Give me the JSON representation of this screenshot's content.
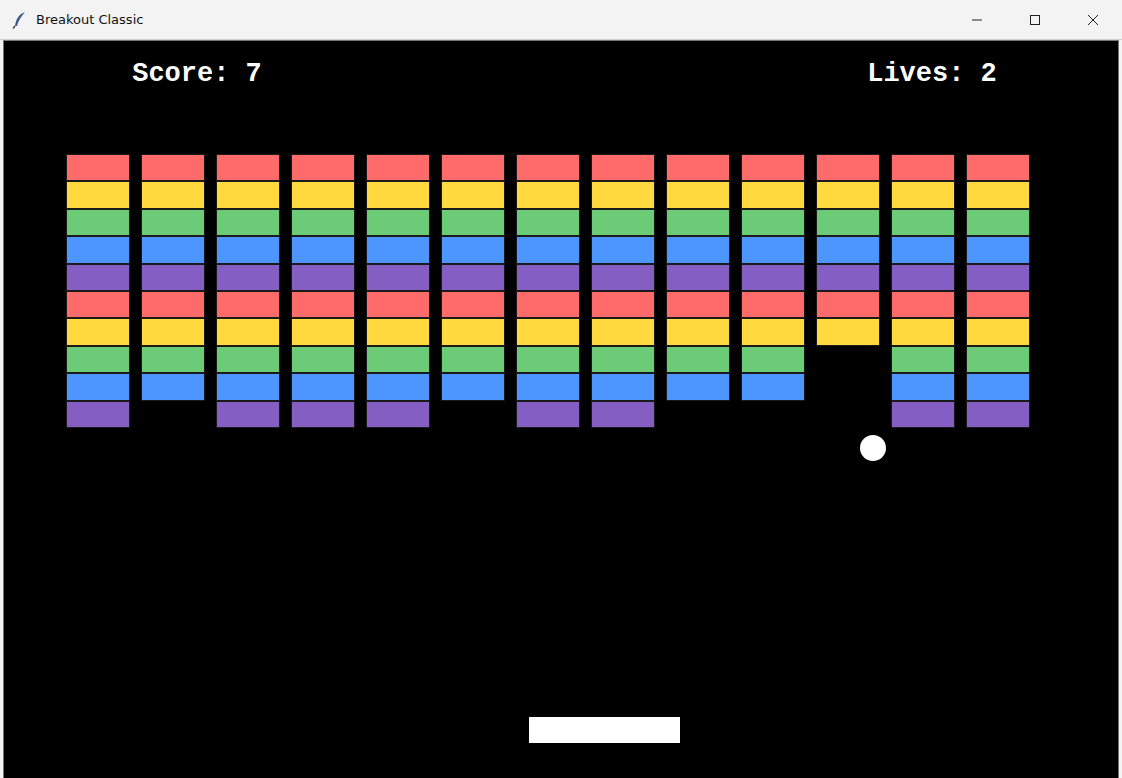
{
  "window": {
    "title": "Breakout Classic"
  },
  "hud": {
    "score": "Score: 7",
    "lives": "Lives: 2"
  },
  "bricks": {
    "rows": [
      {
        "color": "#ff6b6b",
        "bricks": [
          {
            "hit": false
          },
          {
            "hit": false
          },
          {
            "hit": false
          },
          {
            "hit": false
          },
          {
            "hit": false
          },
          {
            "hit": false
          },
          {
            "hit": false
          },
          {
            "hit": false
          },
          {
            "hit": false
          },
          {
            "hit": false
          },
          {
            "hit": false
          },
          {
            "hit": false
          },
          {
            "hit": false
          }
        ]
      },
      {
        "color": "#ffd93d",
        "bricks": [
          {
            "hit": false
          },
          {
            "hit": false
          },
          {
            "hit": false
          },
          {
            "hit": false
          },
          {
            "hit": false
          },
          {
            "hit": false
          },
          {
            "hit": false
          },
          {
            "hit": false
          },
          {
            "hit": false
          },
          {
            "hit": false
          },
          {
            "hit": false
          },
          {
            "hit": false
          },
          {
            "hit": false
          }
        ]
      },
      {
        "color": "#6bcb77",
        "bricks": [
          {
            "hit": false
          },
          {
            "hit": false
          },
          {
            "hit": false
          },
          {
            "hit": false
          },
          {
            "hit": false
          },
          {
            "hit": false
          },
          {
            "hit": false
          },
          {
            "hit": false
          },
          {
            "hit": false
          },
          {
            "hit": false
          },
          {
            "hit": false
          },
          {
            "hit": false
          },
          {
            "hit": false
          }
        ]
      },
      {
        "color": "#4d96ff",
        "bricks": [
          {
            "hit": false
          },
          {
            "hit": false
          },
          {
            "hit": false
          },
          {
            "hit": false
          },
          {
            "hit": false
          },
          {
            "hit": false
          },
          {
            "hit": false
          },
          {
            "hit": false
          },
          {
            "hit": false
          },
          {
            "hit": false
          },
          {
            "hit": false
          },
          {
            "hit": false
          },
          {
            "hit": false
          }
        ]
      },
      {
        "color": "#845ec2",
        "bricks": [
          {
            "hit": false
          },
          {
            "hit": false
          },
          {
            "hit": false
          },
          {
            "hit": false
          },
          {
            "hit": false
          },
          {
            "hit": false
          },
          {
            "hit": false
          },
          {
            "hit": false
          },
          {
            "hit": false
          },
          {
            "hit": false
          },
          {
            "hit": false
          },
          {
            "hit": false
          },
          {
            "hit": false
          }
        ]
      },
      {
        "color": "#ff6b6b",
        "bricks": [
          {
            "hit": false
          },
          {
            "hit": false
          },
          {
            "hit": false
          },
          {
            "hit": false
          },
          {
            "hit": false
          },
          {
            "hit": false
          },
          {
            "hit": false
          },
          {
            "hit": false
          },
          {
            "hit": false
          },
          {
            "hit": false
          },
          {
            "hit": false
          },
          {
            "hit": false
          },
          {
            "hit": false
          }
        ]
      },
      {
        "color": "#ffd93d",
        "bricks": [
          {
            "hit": false
          },
          {
            "hit": false
          },
          {
            "hit": false
          },
          {
            "hit": false
          },
          {
            "hit": false
          },
          {
            "hit": false
          },
          {
            "hit": false
          },
          {
            "hit": false
          },
          {
            "hit": false
          },
          {
            "hit": false
          },
          {
            "hit": false
          },
          {
            "hit": false
          },
          {
            "hit": false
          }
        ]
      },
      {
        "color": "#6bcb77",
        "bricks": [
          {
            "hit": false
          },
          {
            "hit": false
          },
          {
            "hit": false
          },
          {
            "hit": false
          },
          {
            "hit": false
          },
          {
            "hit": false
          },
          {
            "hit": false
          },
          {
            "hit": false
          },
          {
            "hit": false
          },
          {
            "hit": false
          },
          {
            "hit": true
          },
          {
            "hit": false
          },
          {
            "hit": false
          }
        ]
      },
      {
        "color": "#4d96ff",
        "bricks": [
          {
            "hit": false
          },
          {
            "hit": false
          },
          {
            "hit": false
          },
          {
            "hit": false
          },
          {
            "hit": false
          },
          {
            "hit": false
          },
          {
            "hit": false
          },
          {
            "hit": false
          },
          {
            "hit": false
          },
          {
            "hit": false
          },
          {
            "hit": true
          },
          {
            "hit": false
          },
          {
            "hit": false
          }
        ]
      },
      {
        "color": "#845ec2",
        "bricks": [
          {
            "hit": false
          },
          {
            "hit": true
          },
          {
            "hit": false
          },
          {
            "hit": false
          },
          {
            "hit": false
          },
          {
            "hit": true
          },
          {
            "hit": false
          },
          {
            "hit": false
          },
          {
            "hit": true
          },
          {
            "hit": true
          },
          {
            "hit": true
          },
          {
            "hit": false
          },
          {
            "hit": false
          }
        ]
      }
    ]
  }
}
